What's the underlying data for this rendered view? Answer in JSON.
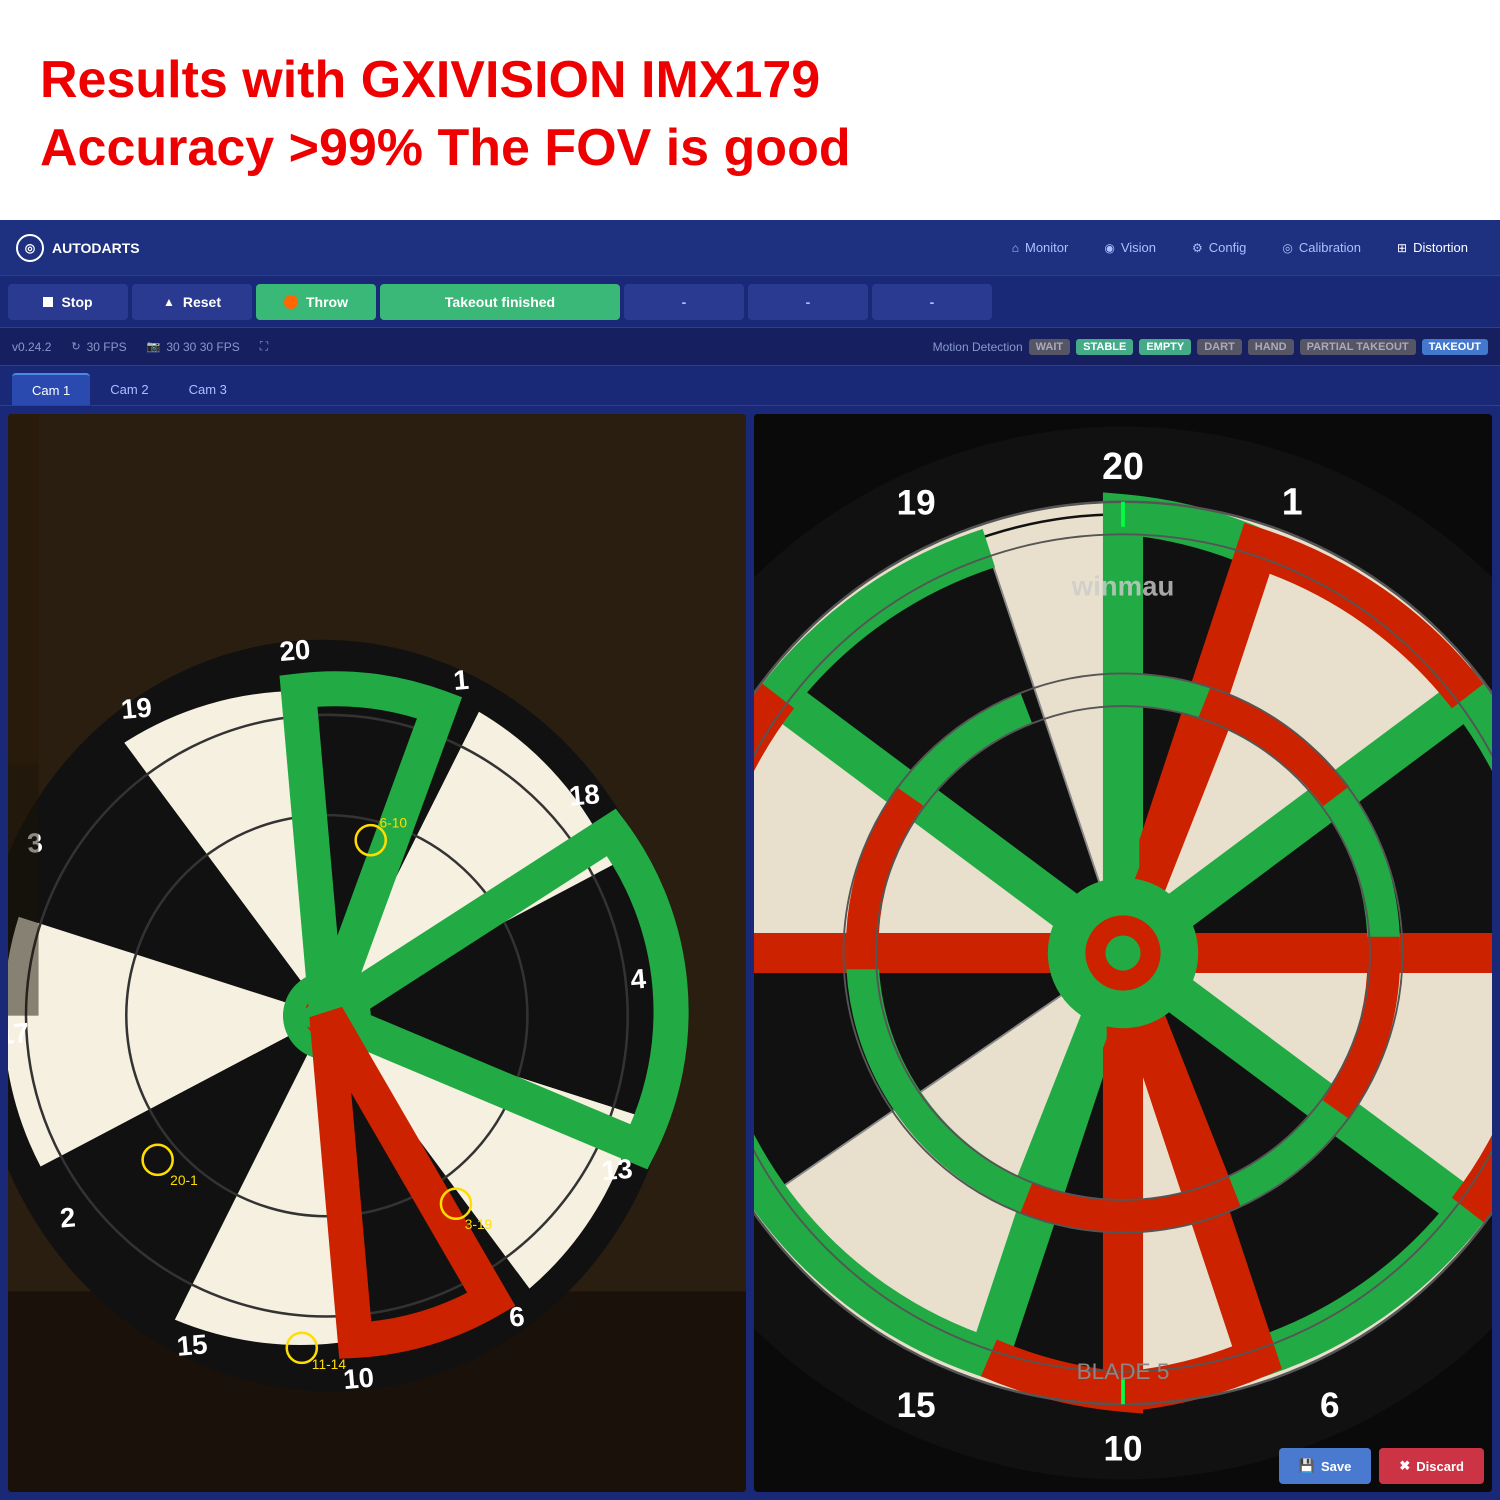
{
  "annotation": {
    "line1": "Results with  GXIVISION   IMX179",
    "line2": "Accuracy >99%  The FOV is good"
  },
  "app": {
    "logo": "AUTODARTS",
    "logo_icon": "◎"
  },
  "navbar": {
    "items": [
      {
        "id": "monitor",
        "icon": "⌂",
        "label": "Monitor"
      },
      {
        "id": "vision",
        "icon": "◉",
        "label": "Vision"
      },
      {
        "id": "config",
        "icon": "⚙",
        "label": "Config"
      },
      {
        "id": "calibration",
        "icon": "◎",
        "label": "Calibration"
      },
      {
        "id": "distortion",
        "icon": "⊞",
        "label": "Distortion"
      }
    ]
  },
  "toolbar": {
    "stop_label": "Stop",
    "reset_label": "Reset",
    "throw_label": "Throw",
    "takeout_label": "Takeout finished",
    "dash1": "-",
    "dash2": "-",
    "dash3": "-"
  },
  "statusbar": {
    "version": "v0.24.2",
    "fps1_icon": "↻",
    "fps1": "30 FPS",
    "fps2_icon": "📷",
    "fps2": "30 30 30 FPS",
    "expand_icon": "⛶",
    "motion_detection_label": "Motion Detection",
    "badges": [
      {
        "id": "wait",
        "label": "WAIT",
        "class": "md-wait"
      },
      {
        "id": "stable",
        "label": "STABLE",
        "class": "md-stable"
      },
      {
        "id": "empty",
        "label": "EMPTY",
        "class": "md-empty"
      },
      {
        "id": "dart",
        "label": "DART",
        "class": "md-dart"
      },
      {
        "id": "hand",
        "label": "HAND",
        "class": "md-hand"
      },
      {
        "id": "partial",
        "label": "PARTIAL TAKEOUT",
        "class": "md-partial"
      },
      {
        "id": "takeout",
        "label": "TAKEOUT",
        "class": "md-takeout"
      }
    ]
  },
  "cam_tabs": [
    {
      "id": "cam1",
      "label": "Cam 1",
      "active": true
    },
    {
      "id": "cam2",
      "label": "Cam 2",
      "active": false
    },
    {
      "id": "cam3",
      "label": "Cam 3",
      "active": false
    }
  ],
  "save_label": "Save",
  "discard_label": "Discard",
  "colors": {
    "accent_blue": "#1a2878",
    "nav_bg": "#1e3080",
    "green": "#3ab878",
    "red_btn": "#cc3344",
    "save_blue": "#4a7ad0"
  }
}
